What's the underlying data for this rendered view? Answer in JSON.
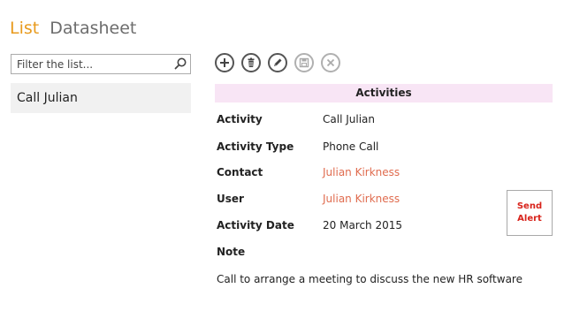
{
  "views": {
    "list_label": "List",
    "datasheet_label": "Datasheet"
  },
  "filter": {
    "placeholder": "Filter the list...",
    "value": ""
  },
  "list": {
    "items": [
      "Call Julian"
    ]
  },
  "toolbar": {
    "buttons": [
      "add-icon",
      "delete-icon",
      "edit-icon",
      "save-icon",
      "cancel-icon"
    ],
    "disabled": [
      "save-icon",
      "cancel-icon"
    ]
  },
  "record": {
    "section_title": "Activities",
    "fields": [
      {
        "label": "Activity",
        "value": "Call Julian"
      },
      {
        "label": "Activity Type",
        "value": "Phone Call"
      },
      {
        "label": "Contact",
        "value": "Julian Kirkness"
      },
      {
        "label": "User",
        "value": "Julian Kirkness"
      },
      {
        "label": "Activity Date",
        "value": "20 March 2015"
      },
      {
        "label": "Note",
        "value": "Call to arrange a meeting to discuss the new HR software"
      }
    ],
    "send_alert_label": "Send Alert"
  },
  "colors": {
    "active_tab": "#e89a1c",
    "link": "#e06c4f",
    "header_bg": "#f8e5f5",
    "alert": "#d8231b"
  }
}
